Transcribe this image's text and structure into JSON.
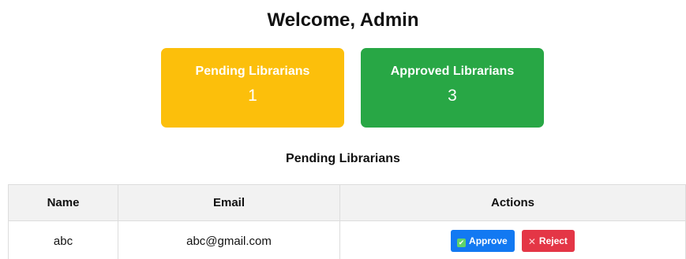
{
  "header": {
    "title": "Welcome, Admin"
  },
  "stats": [
    {
      "label": "Pending Librarians",
      "count": "1",
      "color": "#fcbf0b"
    },
    {
      "label": "Approved Librarians",
      "count": "3",
      "color": "#28a745"
    }
  ],
  "pending_section": {
    "title": "Pending Librarians",
    "columns": [
      "Name",
      "Email",
      "Actions"
    ],
    "rows": [
      {
        "name": "abc",
        "email": "abc@gmail.com",
        "approve_label": "Approve",
        "reject_label": "Reject"
      }
    ]
  },
  "colors": {
    "approve_button": "#1279f2",
    "reject_button": "#e43646",
    "table_header_bg": "#f2f2f2"
  },
  "icons": {
    "approve": "check-box-icon",
    "reject": "x-icon"
  }
}
